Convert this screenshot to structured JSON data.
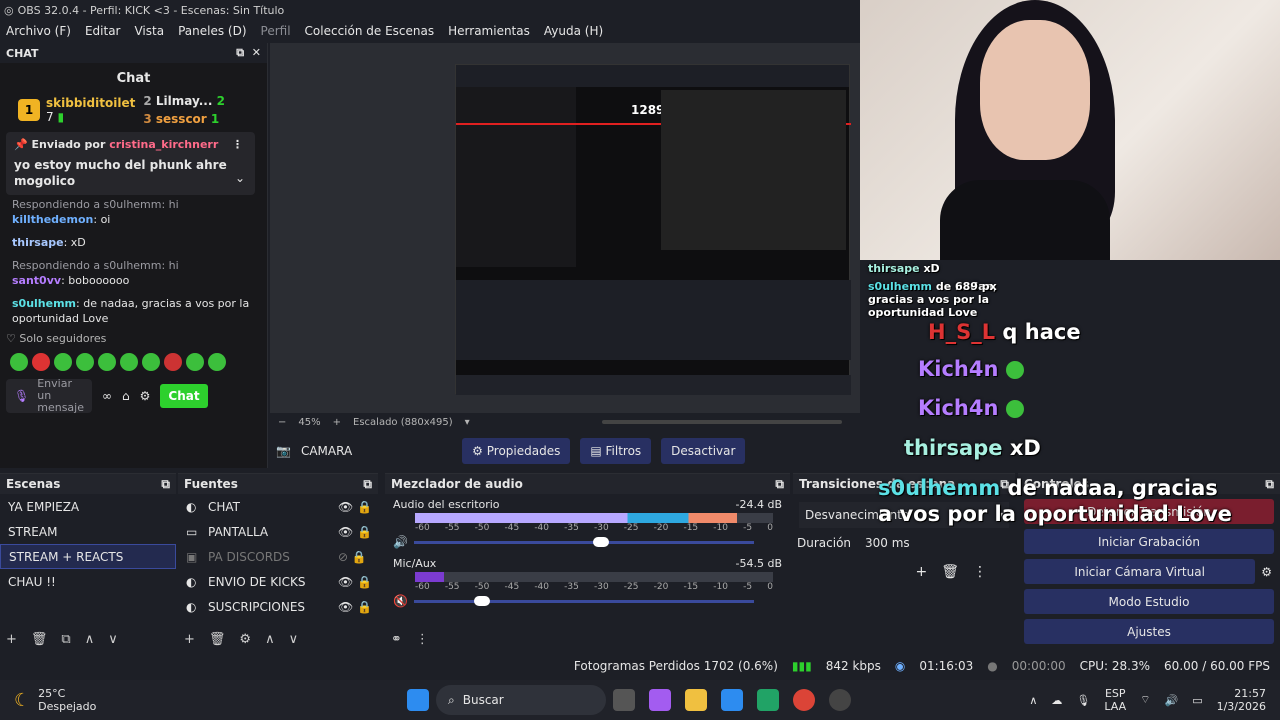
{
  "titlebar": {
    "title": "OBS 32.0.4 - Perfil: KICK <3 - Escenas: Sin Título"
  },
  "menu": [
    "Archivo (F)",
    "Editar",
    "Vista",
    "Paneles (D)",
    "Perfil",
    "Colección de Escenas",
    "Herramientas",
    "Ayuda (H)"
  ],
  "chat": {
    "dock_title": "CHAT",
    "title": "Chat",
    "leaders": [
      {
        "rank": "1",
        "name": "skibbiditoilet",
        "count": "7"
      },
      {
        "rank": "2",
        "name": "Lilmay...",
        "count": "2"
      },
      {
        "rank": "3",
        "name": "sesscor",
        "count": "1"
      }
    ],
    "pinned": {
      "by_label": "Enviado por",
      "by_user": "cristina_kirchnerr",
      "message": "yo estoy mucho del phunk ahre mogolico"
    },
    "messages": [
      {
        "reply": "Respondiendo a s0ulhemm: hi",
        "user": "killthedemon",
        "text": ": oi",
        "cls": "u1"
      },
      {
        "reply": "",
        "user": "thirsape",
        "text": ": xD",
        "cls": "u2"
      },
      {
        "reply": "Respondiendo a s0ulhemm: hi",
        "user": "sant0vv",
        "text": ": boboooooo",
        "cls": "u3"
      },
      {
        "reply": "",
        "user": "s0ulhemm",
        "text": ": de nadaa, gracias a vos por la oportunidad Love",
        "cls": "u4"
      }
    ],
    "followers_only": "Solo seguidores",
    "input_placeholder": "Enviar un mensaje",
    "send": "Chat"
  },
  "preview": {
    "zoom": "45%",
    "scale": "Escalado (880x495)",
    "source": "CAMARA",
    "props": "Propiedades",
    "filters": "Filtros",
    "deactivate": "Desactivar"
  },
  "overlay": {
    "lines": [
      {
        "user": "thirsape",
        "text": "xD"
      },
      {
        "user": "s0ulhemm",
        "text": "de nadaa, gracias a vos por la oportunidad Love"
      },
      {
        "user": "H_S_L",
        "text": "q hace"
      },
      {
        "user": "Kich4n",
        "text": ""
      },
      {
        "user": "Kich4n",
        "text": ""
      },
      {
        "user": "thirsape",
        "text": "xD"
      },
      {
        "user": "s0ulhemm",
        "text": "de nadaa, gracias a vos por la oportunidad Love"
      }
    ],
    "px": "1289 px",
    "px2": "689 px"
  },
  "scenes": {
    "title": "Escenas",
    "items": [
      "YA EMPIEZA",
      "STREAM",
      "STREAM + REACTS",
      "CHAU !!"
    ]
  },
  "sources": {
    "title": "Fuentes",
    "items": [
      "CHAT",
      "PANTALLA",
      "PA DISCORDS",
      "ENVIO DE KICKS",
      "SUSCRIPCIONES"
    ]
  },
  "mixer": {
    "title": "Mezclador de audio",
    "ticks": [
      "-60",
      "-55",
      "-50",
      "-45",
      "-40",
      "-35",
      "-30",
      "-25",
      "-20",
      "-15",
      "-10",
      "-5",
      "0"
    ],
    "channels": [
      {
        "name": "Audio del escritorio",
        "db": "-24.4 dB",
        "level": 0.9,
        "volume": 0.55
      },
      {
        "name": "Mic/Aux",
        "db": "-54.5 dB",
        "level": 0.08,
        "volume": 0.2
      }
    ]
  },
  "transitions": {
    "title": "Transiciones de escena",
    "selected": "Desvanecimiento",
    "duration_label": "Duración",
    "duration": "300 ms"
  },
  "controls": {
    "title": "Controles",
    "buttons": [
      "Detener Transmisión",
      "Iniciar Grabación",
      "Iniciar Cámara Virtual",
      "Modo Estudio",
      "Ajustes"
    ]
  },
  "status": {
    "frames": "Fotogramas Perdidos 1702 (0.6%)",
    "kbps": "842 kbps",
    "live": "01:16:03",
    "rec": "00:00:00",
    "cpu": "CPU: 28.3%",
    "fps": "60.00 / 60.00 FPS"
  },
  "taskbar": {
    "temp": "25°C",
    "weather": "Despejado",
    "search": "Buscar",
    "lang1": "ESP",
    "lang2": "LAA",
    "time": "21:57",
    "date": "1/3/2026"
  }
}
